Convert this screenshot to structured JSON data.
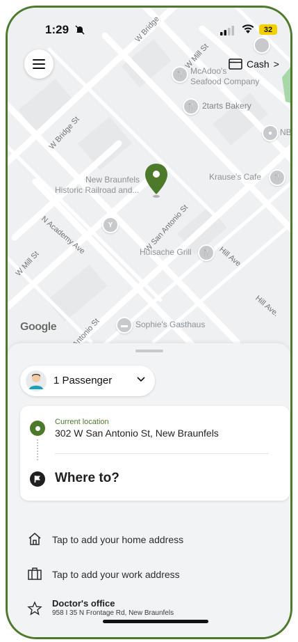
{
  "status_bar": {
    "time": "1:29",
    "battery": "32"
  },
  "top": {
    "menu_icon": "hamburger-menu-icon",
    "cash_label": "Cash",
    "cash_chevron": ">"
  },
  "map": {
    "pois": [
      {
        "name": "McAdoo's",
        "line2": "Seafood Company"
      },
      {
        "name": "2tarts Bakery"
      },
      {
        "name": "NBT"
      },
      {
        "name": "New Braunfels",
        "line2": "Historic Railroad and..."
      },
      {
        "name": "Krause's Cafe"
      },
      {
        "name": "Huisache Grill"
      },
      {
        "name": "Sophie's Gasthaus"
      }
    ],
    "streets": [
      "W Bridge",
      "W Mill St",
      "W Bridge St",
      "N Academy Ave",
      "W San Antonio St",
      "Hill Ave",
      "W Mill St",
      "Hill Ave.",
      "Antonio St"
    ],
    "attribution": "Google",
    "accent_color": "#4d7a2a"
  },
  "sheet": {
    "passenger_label": "1 Passenger",
    "current_location_label": "Current location",
    "current_address": "302 W San Antonio St, New Braunfels",
    "where_to": "Where to?",
    "home_shortcut": "Tap to add your home address",
    "work_shortcut": "Tap to add your work address",
    "saved_place": {
      "title": "Doctor's office",
      "address": "958 I 35 N Frontage Rd, New Braunfels"
    }
  }
}
